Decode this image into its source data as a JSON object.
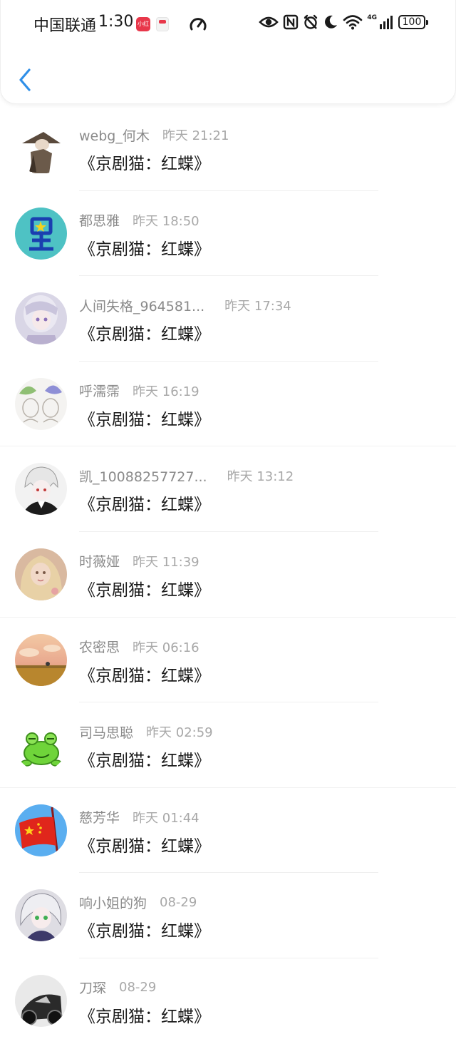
{
  "status_bar": {
    "carrier": "中国联通",
    "time": "1:30",
    "badge_text": "小红书",
    "net_label": "4G",
    "battery": "100"
  },
  "header": {
    "back_icon": "chevron-left-icon",
    "accent_color": "#2f8fe8"
  },
  "comments": [
    {
      "username": "webg_何木",
      "time": "昨天 21:21",
      "text": "《京剧猫：红蝶》",
      "avatar": "avatar-straw-hat-figure"
    },
    {
      "username": "都思雅",
      "time": "昨天 18:50",
      "text": "《京剧猫：红蝶》",
      "avatar": "avatar-star-glyph"
    },
    {
      "username": "人间失格_964581...",
      "time": "昨天 17:34",
      "text": "《京剧猫：红蝶》",
      "avatar": "avatar-anime-girl-silver"
    },
    {
      "username": "呼濡霈",
      "time": "昨天 16:19",
      "text": "《京剧猫：红蝶》",
      "avatar": "avatar-sketch-twins"
    },
    {
      "username": "凯_10088257727...",
      "time": "昨天 13:12",
      "text": "《京剧猫：红蝶》",
      "avatar": "avatar-white-hair-boy"
    },
    {
      "username": "时薇娅",
      "time": "昨天 11:39",
      "text": "《京剧猫：红蝶》",
      "avatar": "avatar-blonde-girl"
    },
    {
      "username": "农密思",
      "time": "昨天 06:16",
      "text": "《京剧猫：红蝶》",
      "avatar": "avatar-sunset-field"
    },
    {
      "username": "司马思聪",
      "time": "昨天 02:59",
      "text": "《京剧猫：红蝶》",
      "avatar": "avatar-green-frog"
    },
    {
      "username": "慈芳华",
      "time": "昨天 01:44",
      "text": "《京剧猫：红蝶》",
      "avatar": "avatar-red-flag"
    },
    {
      "username": "响小姐的狗",
      "time": "08-29",
      "text": "《京剧猫：红蝶》",
      "avatar": "avatar-green-eyed-girl"
    },
    {
      "username": "刀琛",
      "time": "08-29",
      "text": "《京剧猫：红蝶》",
      "avatar": "avatar-motorbike"
    }
  ]
}
